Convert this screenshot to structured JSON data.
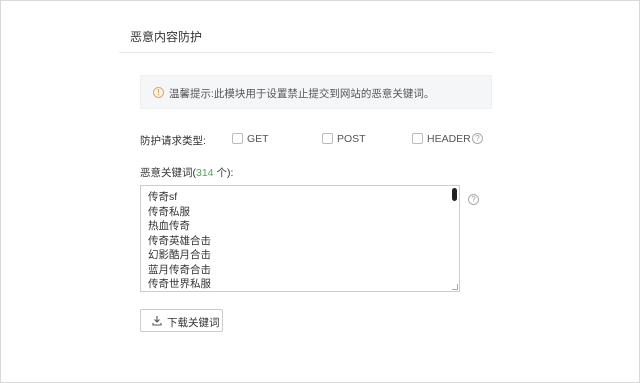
{
  "section": {
    "title": "恶意内容防护"
  },
  "tip": {
    "icon": "warning-icon",
    "text": "温馨提示:此模块用于设置禁止提交到网站的恶意关键词。"
  },
  "request_types": {
    "label": "防护请求类型:",
    "options": [
      {
        "label": "GET",
        "checked": false
      },
      {
        "label": "POST",
        "checked": false
      },
      {
        "label": "HEADER",
        "checked": false
      }
    ]
  },
  "keywords": {
    "label_prefix": "恶意关键词(",
    "count": "314",
    "label_suffix": " 个):",
    "items": [
      "传奇sf",
      "传奇私服",
      "热血传奇",
      "传奇英雄合击",
      "幻影酷月合击",
      "蓝月传奇合击",
      "传奇世界私服"
    ]
  },
  "download_button": {
    "label": "下载关键词",
    "icon": "download-icon"
  },
  "colors": {
    "accent_green": "#4cae4c",
    "warning": "#f0a640"
  }
}
